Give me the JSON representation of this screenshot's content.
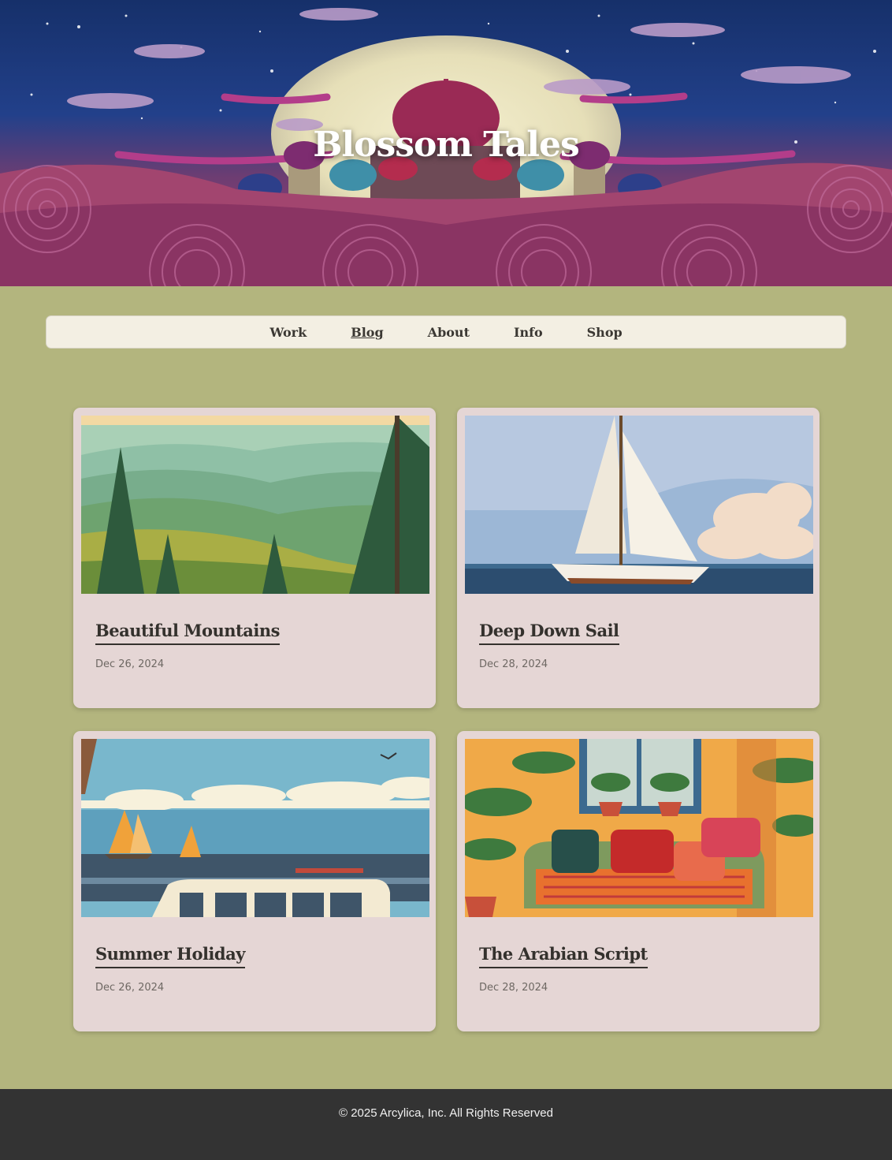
{
  "site": {
    "title": "Blossom Tales"
  },
  "nav": {
    "items": [
      {
        "label": "Work",
        "active": false
      },
      {
        "label": "Blog",
        "active": true
      },
      {
        "label": "About",
        "active": false
      },
      {
        "label": "Info",
        "active": false
      },
      {
        "label": "Shop",
        "active": false
      }
    ]
  },
  "posts": [
    {
      "title": "Beautiful Mountains",
      "date": "Dec 26, 2024",
      "image": "mountain-forest-painting"
    },
    {
      "title": "Deep Down Sail",
      "date": "Dec 28, 2024",
      "image": "sailboat-painting"
    },
    {
      "title": "Summer Holiday",
      "date": "Dec 26, 2024",
      "image": "beach-van-painting"
    },
    {
      "title": "The Arabian Script",
      "date": "Dec 28, 2024",
      "image": "tropical-sofa-painting"
    }
  ],
  "footer": {
    "copyright": "© 2025 Arcylica, Inc. All Rights Reserved"
  }
}
